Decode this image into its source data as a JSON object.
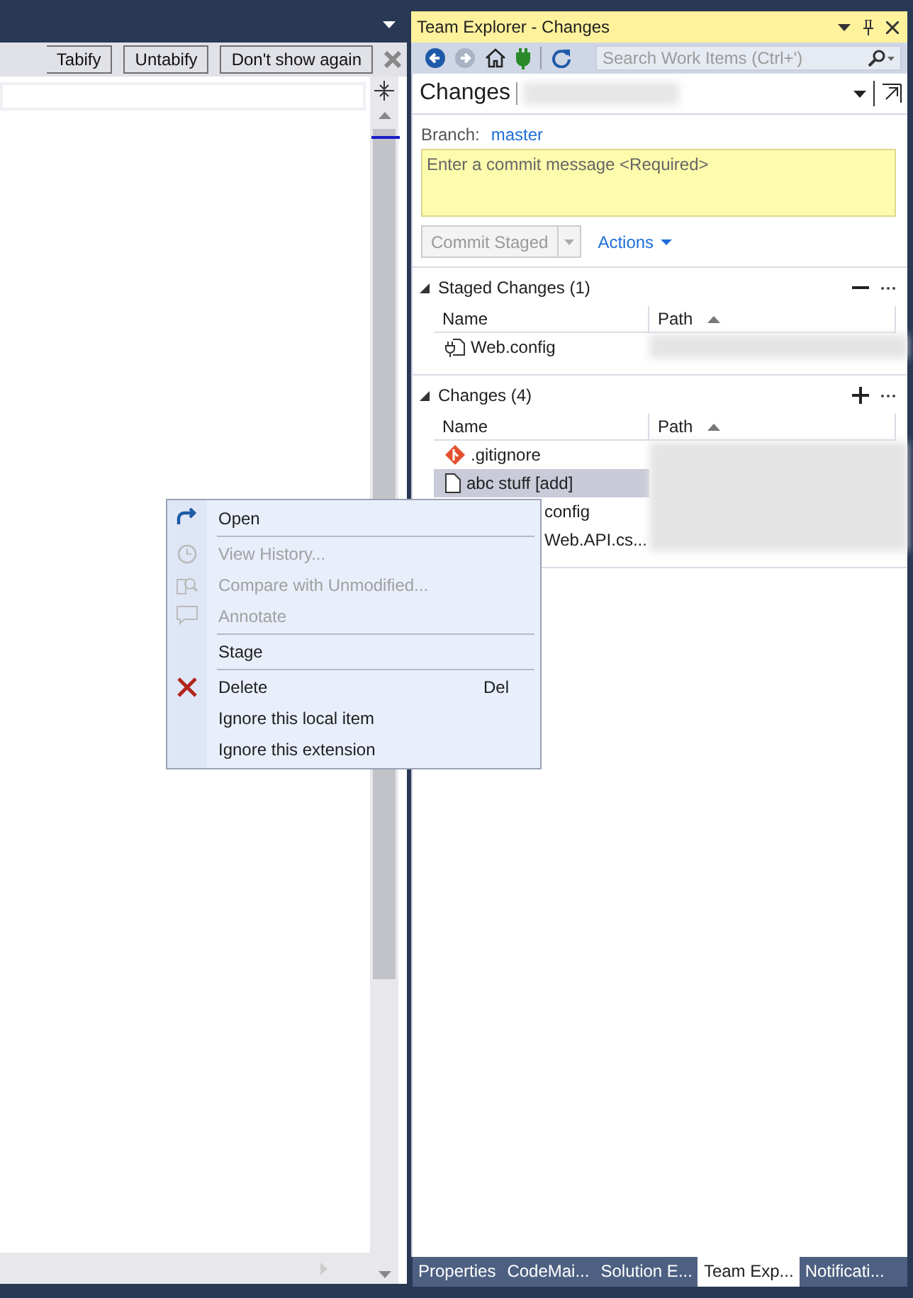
{
  "editor": {
    "infobar_buttons": [
      "Tabify",
      "Untabify",
      "Don't show again"
    ]
  },
  "team_explorer": {
    "title": "Team Explorer - Changes",
    "search": {
      "placeholder": "Search Work Items (Ctrl+')"
    },
    "page_title": "Changes",
    "branch_label": "Branch:",
    "branch": "master",
    "commit_message": {
      "placeholder": "Enter a commit message <Required>"
    },
    "commit_button": {
      "label": "Commit Staged",
      "disabled": true
    },
    "actions": "Actions",
    "sections": [
      {
        "title": "Staged Changes (1)",
        "kind": "staged",
        "expanded": true,
        "columns": [
          {
            "label": "Name",
            "sorted": false
          },
          {
            "label": "Path",
            "sorted": true
          }
        ],
        "rows": [
          {
            "name": "Web.config",
            "kind": "config",
            "selected": false
          }
        ]
      },
      {
        "title": "Changes (4)",
        "kind": "changes",
        "expanded": true,
        "columns": [
          {
            "label": "Name",
            "sorted": false
          },
          {
            "label": "Path",
            "sorted": true
          }
        ],
        "rows": [
          {
            "name": ".gitignore",
            "kind": "git",
            "selected": false
          },
          {
            "name": "abc stuff [add]",
            "kind": "file",
            "selected": true
          },
          {
            "name": "config",
            "kind": "covered",
            "selected": false
          },
          {
            "name": "Web.API.cs...",
            "kind": "covered",
            "selected": false
          }
        ]
      }
    ]
  },
  "context_menu": {
    "items": [
      {
        "label": "Open",
        "kind": "open",
        "disabled": false,
        "separator_after": true
      },
      {
        "label": "View History...",
        "kind": "history",
        "disabled": true,
        "separator_after": false
      },
      {
        "label": "Compare with Unmodified...",
        "kind": "compare",
        "disabled": true,
        "separator_after": false
      },
      {
        "label": "Annotate",
        "kind": "annotate",
        "disabled": true,
        "separator_after": true
      },
      {
        "label": "Stage",
        "kind": "plain",
        "disabled": false,
        "separator_after": true
      },
      {
        "label": "Delete",
        "kind": "delete",
        "shortcut": "Del",
        "disabled": false,
        "separator_after": false
      },
      {
        "label": "Ignore this local item",
        "kind": "plain",
        "disabled": false,
        "separator_after": false
      },
      {
        "label": "Ignore this extension",
        "kind": "plain",
        "disabled": false,
        "separator_after": false
      }
    ]
  },
  "bottom_tabs": [
    {
      "label": "Properties",
      "selected": false
    },
    {
      "label": "CodeMai...",
      "selected": false
    },
    {
      "label": "Solution E...",
      "selected": false
    },
    {
      "label": "Team Exp...",
      "selected": true
    },
    {
      "label": "Notificati...",
      "selected": false
    }
  ]
}
